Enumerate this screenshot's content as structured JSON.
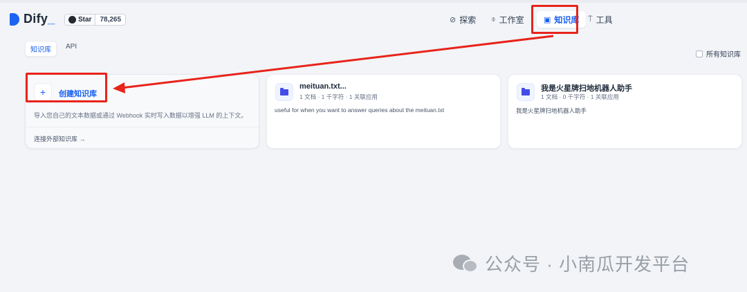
{
  "header": {
    "logo_text": "Dify",
    "logo_dot": "_",
    "star_label": "Star",
    "star_count": "78,265",
    "nav": [
      {
        "label": "探索",
        "icon": "compass-icon"
      },
      {
        "label": "工作室",
        "icon": "robot-icon"
      },
      {
        "label": "知识库",
        "icon": "book-icon",
        "active": true
      },
      {
        "label": "工具",
        "icon": "hammer-icon"
      }
    ]
  },
  "tabs": [
    {
      "label": "知识库",
      "active": true
    },
    {
      "label": "API",
      "active": false
    }
  ],
  "filter": {
    "all_kb_label": "所有知识库"
  },
  "create_card": {
    "plus": "+",
    "title": "创建知识库",
    "description": "导入您自己的文本数据或通过 Webhook 实时写入数据以增强 LLM 的上下文。",
    "connect_link": "连接外部知识库 →"
  },
  "knowledge_bases": [
    {
      "name": "meituan.txt...",
      "meta": "1 文档 · 1 千字符 · 1 关联应用",
      "description": "useful for when you want to answer queries about the meituan.txt"
    },
    {
      "name": "我是火星牌扫地机器人助手",
      "meta": "1 文档 · 0 千字符 · 1 关联应用",
      "description": "我是火星牌扫地机器人助手"
    }
  ],
  "watermark": {
    "text": "公众号 · 小南瓜开发平台"
  },
  "colors": {
    "accent": "#155eef",
    "annotation_red": "#e8231a",
    "background": "#f2f4f7"
  }
}
